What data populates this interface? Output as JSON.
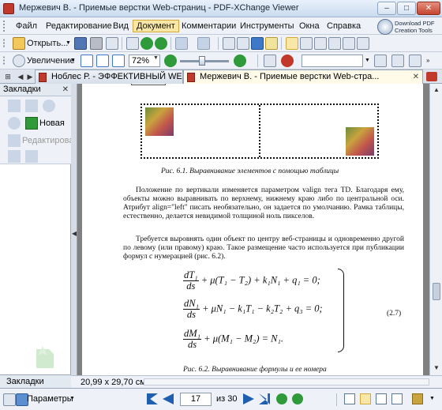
{
  "window": {
    "title": "Мержевич В. - Приемые верстки Web-страниц - PDF-XChange Viewer",
    "controls": {
      "minimize": "–",
      "maximize": "□",
      "close": "✕"
    }
  },
  "menubar": {
    "items": [
      "Файл",
      "Редактирование",
      "Вид",
      "Документ",
      "Комментарии",
      "Инструменты",
      "Окна",
      "Справка"
    ],
    "active_index": 3,
    "download": "Download PDF\nCreation Tools"
  },
  "toolbar1": {
    "open_label": "Открыть..."
  },
  "toolbar2": {
    "zoom_label": "Увеличение",
    "zoom_value": "72%"
  },
  "tabs": [
    {
      "label": "Ноблес Р. - ЭФФЕКТИВНЫЙ WEB-САЙТ"
    },
    {
      "label": "Мержевич В. - Приемые верстки Web-стра..."
    }
  ],
  "tab_close": "✕",
  "bookmarks_panel": {
    "title": "Закладки",
    "close": "✕",
    "new_label": "Новая",
    "edit_label": "Редактироват",
    "bottom_tab": "Закладки"
  },
  "page": {
    "figure1_caption": "Рис. 6.1. Выравнивание элементов с помощью таблицы",
    "para1": "Положение по вертикали изменяется параметром valign тега TD. Благодаря ему, объекты можно выравнивать по верхнему, нижнему краю либо по центральной оси. Атрибут align=\"left\" писать необязательно, он задается по умолчанию. Рамка таблицы, естественно, делается невидимой толщиной ноль пикселов.",
    "para2": "Требуется выровнять один объект по центру веб-страницы и одновременно другой по левому (или правому) краю. Такое размещение часто используется при публикации формул с нумерацией (рис. 6.2).",
    "formula1": {
      "num": "dT₁",
      "den": "ds",
      "rest": "+ μ(T₁ − T₂) + k₁N₁ + q₁ = 0;"
    },
    "formula2": {
      "num": "dN₁",
      "den": "ds",
      "rest": "+ μN₁ − k₁T₁ − k₂T₂ + q₃ = 0;"
    },
    "formula3": {
      "num": "dM₁",
      "den": "ds",
      "rest": "+ μ(M₁ − M₂) = N₁."
    },
    "equation_number": "(2.7)",
    "figure2_caption": "Рис. 6.2. Выравнивание формулы и ее номера"
  },
  "status": {
    "page_size": "20,99 x 29,70 см"
  },
  "bottombar": {
    "options_label": "Параметры",
    "current_page": "17",
    "of_label": "из 30"
  },
  "colors": {
    "accent": "#1f5fb0",
    "green": "#2e9a3a",
    "tab_active": "#fffbe8"
  }
}
